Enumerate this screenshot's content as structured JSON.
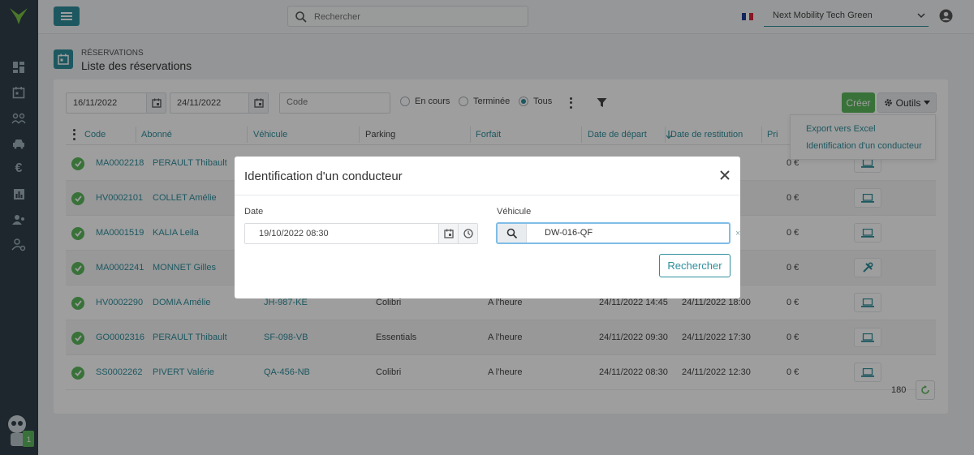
{
  "topbar": {
    "search_placeholder": "Rechercher",
    "organization": "Next Mobility Tech Green",
    "accent": "#2f8e9c"
  },
  "page": {
    "breadcrumb": "RÉSERVATIONS",
    "title": "Liste des réservations"
  },
  "filters": {
    "date_from": "16/11/2022",
    "date_to": "24/11/2022",
    "code_placeholder": "Code",
    "status_options": [
      "En cours",
      "Terminée",
      "Tous"
    ],
    "status_selected": "Tous"
  },
  "toolbar": {
    "create_label": "Créer",
    "tools_label": "Outils",
    "menu": [
      "Export vers Excel",
      "Identification d'un conducteur"
    ]
  },
  "table": {
    "columns": [
      "Code",
      "Abonné",
      "Véhicule",
      "Parking",
      "Forfait",
      "Date de départ",
      "Date de restitution",
      "Pri"
    ],
    "rows": [
      {
        "code": "MA0002218",
        "subscriber": "PERAULT Thibault",
        "vehicle": "",
        "parking": "",
        "plan": "",
        "departure": "",
        "return": "",
        "price": "0 €",
        "action": "laptop-icon"
      },
      {
        "code": "HV0002101",
        "subscriber": "COLLET Amélie",
        "vehicle": "",
        "parking": "",
        "plan": "",
        "departure": "",
        "return": "",
        "price": "0 €",
        "action": "laptop-icon"
      },
      {
        "code": "MA0001519",
        "subscriber": "KALIA Leila",
        "vehicle": "",
        "parking": "",
        "plan": "",
        "departure": "",
        "return": "",
        "price": "0 €",
        "action": "laptop-icon"
      },
      {
        "code": "MA0002241",
        "subscriber": "MONNET Gilles",
        "vehicle": "",
        "parking": "",
        "plan": "",
        "departure": "",
        "return": "",
        "price": "0 €",
        "action": "tools-icon"
      },
      {
        "code": "HV0002290",
        "subscriber": "DOMIA Amélie",
        "vehicle": "JH-987-KE",
        "parking": "Colibri",
        "plan": "A l'heure",
        "departure": "24/11/2022 14:45",
        "return": "24/11/2022 18:00",
        "price": "0 €",
        "action": "laptop-icon"
      },
      {
        "code": "GO0002316",
        "subscriber": "PERAULT Thibault",
        "vehicle": "SF-098-VB",
        "parking": "Essentials",
        "plan": "A l'heure",
        "departure": "24/11/2022 09:30",
        "return": "24/11/2022 17:30",
        "price": "0 €",
        "action": "laptop-icon"
      },
      {
        "code": "SS0002262",
        "subscriber": "PIVERT Valérie",
        "vehicle": "QA-456-NB",
        "parking": "Colibri",
        "plan": "A l'heure",
        "departure": "24/11/2022 08:30",
        "return": "24/11/2022 12:30",
        "price": "0 €",
        "action": "laptop-icon"
      }
    ],
    "total": "180"
  },
  "modal": {
    "title": "Identification d'un conducteur",
    "date_label": "Date",
    "date_value": "19/10/2022 08:30",
    "vehicle_label": "Véhicule",
    "vehicle_value": "DW-016-QF",
    "clear": "×",
    "search_label": "Rechercher"
  }
}
